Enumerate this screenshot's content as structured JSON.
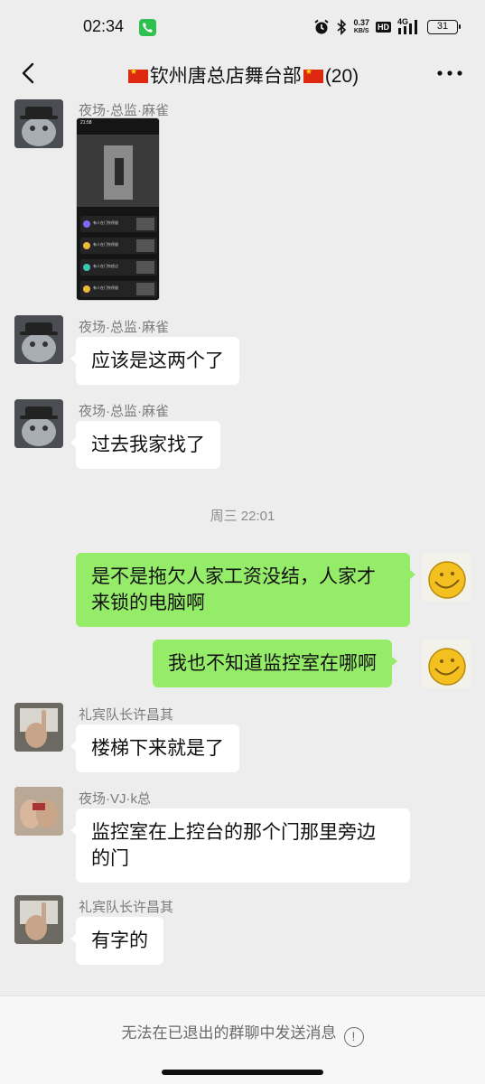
{
  "status_bar": {
    "time": "02:34",
    "net_speed_value": "0.37",
    "net_speed_unit": "KB/S",
    "hd_badge": "HD",
    "network": "4G",
    "battery": "31",
    "icons": [
      "call-icon",
      "alarm-icon",
      "bluetooth-icon",
      "signal-icon",
      "battery-icon"
    ]
  },
  "nav": {
    "title": "钦州唐总店舞台部",
    "member_count": "(20)",
    "back_icon": "chevron-left-icon",
    "more_icon": "more-dots-icon"
  },
  "messages": [
    {
      "sender": "夜场·总监·麻雀",
      "type": "image",
      "avatar": "cat-hat-avatar"
    },
    {
      "sender": "夜场·总监·麻雀",
      "text": "应该是这两个了"
    },
    {
      "sender": "夜场·总监·麻雀",
      "text": "过去我家找了"
    },
    {
      "text_line1": "是不是拖欠人家工资没结，人家才",
      "text_line2": "来锁的电脑啊",
      "self": true
    },
    {
      "text": "我也不知道监控室在哪啊",
      "self": true
    },
    {
      "sender": "礼宾队长许昌其",
      "text": "楼梯下来就是了"
    },
    {
      "sender": "夜场·VJ·k总",
      "text_line1": "监控室在上控台的那个门那里旁边",
      "text_line2": "的门"
    },
    {
      "sender": "礼宾队长许昌其",
      "text": "有字的"
    }
  ],
  "timestamp": "周三 22:01",
  "shared_image": {
    "clock": "21:58",
    "rows": [
      "有人在门铃停留",
      "有人在门铃停留",
      "有人在门铃经过",
      "有人在门铃停留"
    ]
  },
  "bottom": {
    "notice": "无法在已退出的群聊中发送消息",
    "info_icon": "!"
  },
  "colors": {
    "background": "#ededed",
    "self_bubble": "#95ec69",
    "other_bubble": "#ffffff",
    "sender_name": "#7b7b7b"
  }
}
